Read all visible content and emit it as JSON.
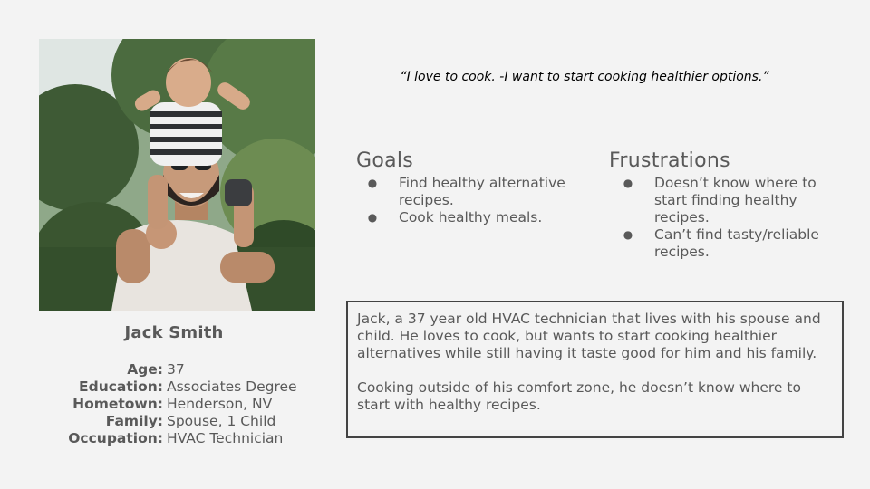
{
  "persona": {
    "name": "Jack Smith",
    "photo_icon": "persona-photo"
  },
  "details": [
    {
      "label": "Age:",
      "value": "37"
    },
    {
      "label": "Education:",
      "value": "Associates Degree"
    },
    {
      "label": "Hometown:",
      "value": "Henderson, NV"
    },
    {
      "label": "Family:",
      "value": "Spouse, 1 Child"
    },
    {
      "label": "Occupation:",
      "value": "HVAC Technician"
    }
  ],
  "quote": "“I love to cook. -I want to start cooking healthier options.”",
  "goals": {
    "title": "Goals",
    "items": [
      "Find healthy alternative recipes.",
      "Cook healthy meals."
    ]
  },
  "frustrations": {
    "title": "Frustrations",
    "items": [
      "Doesn’t know where to start finding healthy recipes.",
      "Can’t find tasty/reliable recipes."
    ]
  },
  "bio": {
    "paragraphs": [
      "Jack, a 37 year old HVAC technician that lives with his spouse and child. He loves to cook, but wants to start cooking healthier alternatives while still having it taste good for him and his family.",
      "Cooking outside of his comfort zone, he doesn’t know where to start with healthy recipes."
    ]
  },
  "colors": {
    "background": "#f3f3f3",
    "text": "#595959",
    "quote": "#000000",
    "border": "#434343"
  }
}
